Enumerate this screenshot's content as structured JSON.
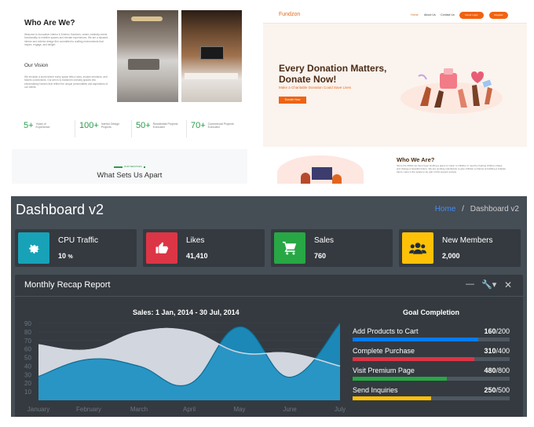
{
  "about": {
    "heading": "Who Are We?",
    "para1": "Welcome to Innovative Interior & Exterior Solutions, where creativity meets functionality to redefine spaces and elevate experiences. We are a dynamic interior and exterior design firm committed to crafting environments that inspire, engage, and delight.",
    "vision_heading": "Our Vision",
    "para2": "We envision a world where every space tells a story, evokes emotions, and fosters connections. Our aim is to transform ordinary spaces into extraordinary havens that reflect the unique personalities and aspirations of our clients.",
    "stats": [
      {
        "num": "5+",
        "label": "Years of Experience"
      },
      {
        "num": "100+",
        "label": "Interior Design Projects"
      },
      {
        "num": "50+",
        "label": "Residential Projects Executed"
      },
      {
        "num": "70+",
        "label": "Commercial Projects Executed"
      }
    ],
    "tag": "OUR SERVICES",
    "apart": "What Sets Us Apart"
  },
  "fundzon": {
    "logo": "Fundzon",
    "nav": [
      "Home",
      "About Us",
      "Contact Us"
    ],
    "donor_login": "Donor Login",
    "register": "Register",
    "hero_title": "Every Donation Matters, Donate Now!",
    "hero_sub": "Make a Charitable Donation Could Save Lives",
    "cta": "Donate Now",
    "who_heading": "Who We Are?",
    "who_text": "Since the 2010s we have been lending a grace to vision to children in need by helping children shape and change a beautiful future. We are working relentlessly to give children a chance at building a brighter future. Here is the space to be part of this support society."
  },
  "dashboard": {
    "title": "Dashboard v2",
    "breadcrumb": {
      "home": "Home",
      "sep": "/",
      "current": "Dashboard v2"
    },
    "info_boxes": [
      {
        "label": "CPU Traffic",
        "value": "10",
        "unit": "%",
        "color": "#17a2b8",
        "icon": "gear-icon"
      },
      {
        "label": "Likes",
        "value": "41,410",
        "unit": "",
        "color": "#dc3545",
        "icon": "thumbs-up-icon"
      },
      {
        "label": "Sales",
        "value": "760",
        "unit": "",
        "color": "#28a745",
        "icon": "cart-icon"
      },
      {
        "label": "New Members",
        "value": "2,000",
        "unit": "",
        "color": "#ffc107",
        "icon": "users-icon"
      }
    ],
    "report": {
      "title": "Monthly Recap Report",
      "chart_title": "Sales: 1 Jan, 2014 - 30 Jul, 2014",
      "goal_title": "Goal Completion",
      "goals": [
        {
          "label": "Add Products to Cart",
          "done": "160",
          "total": "/200",
          "pct": 0.8,
          "color": "#007bff"
        },
        {
          "label": "Complete Purchase",
          "done": "310",
          "total": "/400",
          "pct": 0.775,
          "color": "#dc3545"
        },
        {
          "label": "Visit Premium Page",
          "done": "480",
          "total": "/800",
          "pct": 0.6,
          "color": "#28a745"
        },
        {
          "label": "Send Inquiries",
          "done": "250",
          "total": "/500",
          "pct": 0.5,
          "color": "#ffc107"
        }
      ]
    }
  },
  "chart_data": {
    "type": "area",
    "title": "Sales: 1 Jan, 2014 - 30 Jul, 2014",
    "categories": [
      "January",
      "February",
      "March",
      "April",
      "May",
      "June",
      "July"
    ],
    "yticks": [
      10,
      20,
      30,
      40,
      50,
      60,
      70,
      80,
      90
    ],
    "ylim": [
      0,
      90
    ],
    "series": [
      {
        "values": [
          28,
          48,
          40,
          19,
          86,
          27,
          90
        ],
        "color": "#1a8fc1"
      },
      {
        "values": [
          65,
          59,
          80,
          81,
          56,
          55,
          40
        ],
        "color": "#d2d6de"
      }
    ],
    "grid": true
  }
}
